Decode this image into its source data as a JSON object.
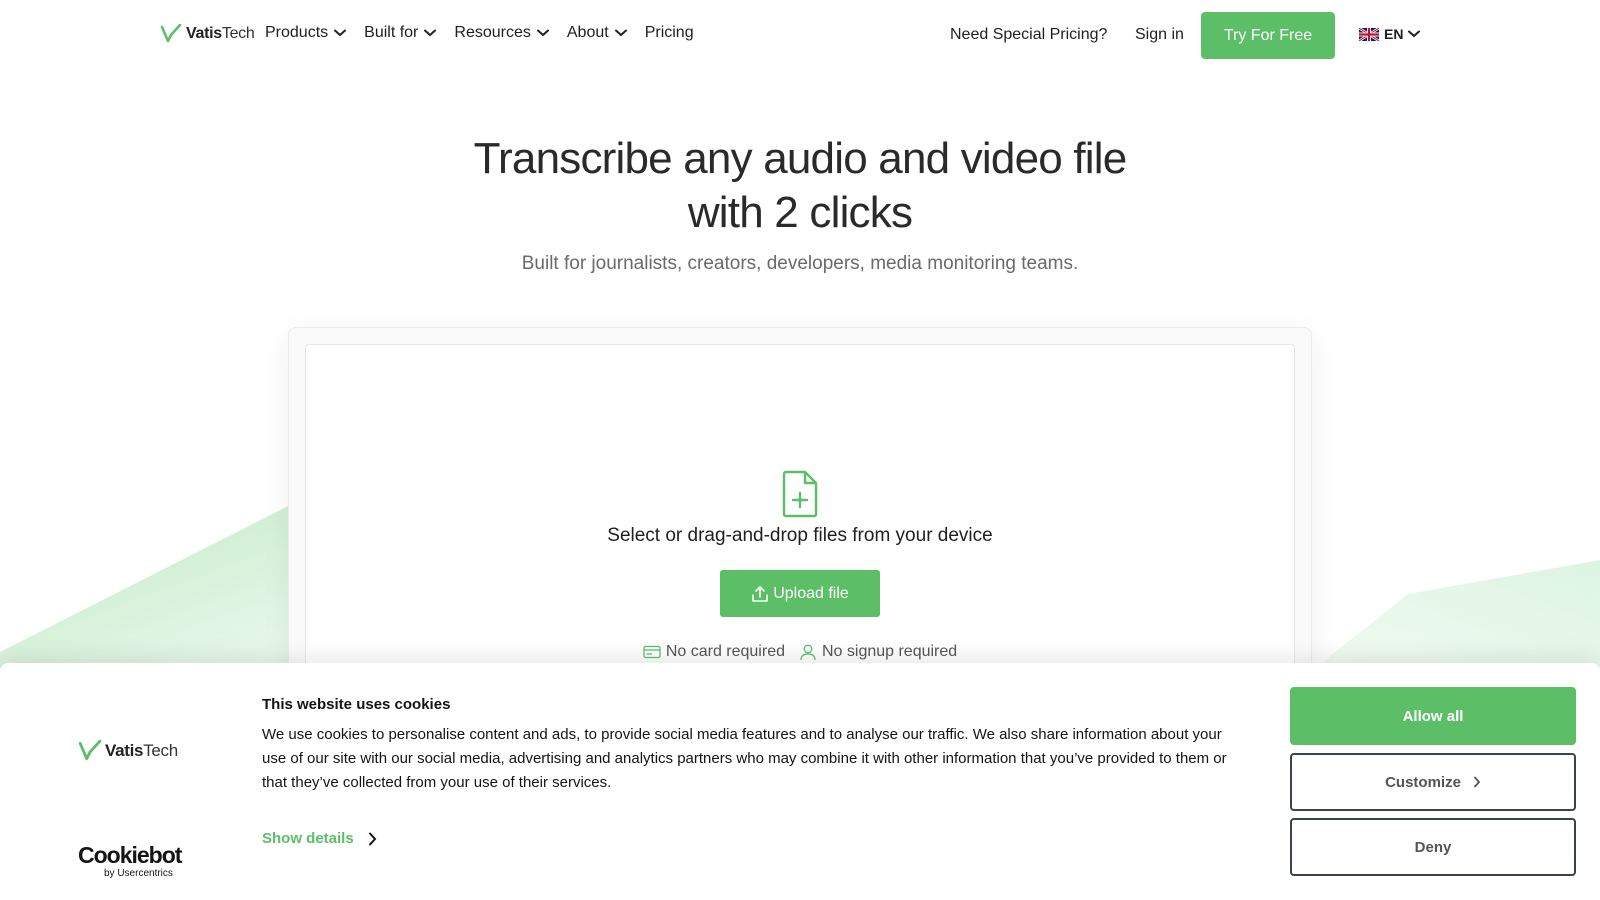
{
  "brand": {
    "name_bold": "Vatis",
    "name_light": "Tech",
    "accent_color": "#5cbf68"
  },
  "nav": {
    "items": [
      {
        "label": "Products",
        "has_dropdown": true
      },
      {
        "label": "Built for",
        "has_dropdown": true
      },
      {
        "label": "Resources",
        "has_dropdown": true
      },
      {
        "label": "About",
        "has_dropdown": true
      },
      {
        "label": "Pricing",
        "has_dropdown": false
      }
    ],
    "special_pricing": "Need Special Pricing?",
    "sign_in": "Sign in",
    "try_free": "Try For Free",
    "language": {
      "code": "EN",
      "flag_icon": "uk-flag-icon"
    }
  },
  "hero": {
    "title_line1": "Transcribe any audio and video file",
    "title_line2": "with 2 clicks",
    "subtitle": "Built for journalists, creators, developers, media monitoring teams."
  },
  "upload": {
    "icon": "file-plus-icon",
    "prompt": "Select or drag-and-drop files from your device",
    "button_label": "Upload file",
    "features": [
      {
        "icon": "credit-card-icon",
        "label": "No card required"
      },
      {
        "icon": "user-icon",
        "label": "No signup required"
      }
    ]
  },
  "cookie_banner": {
    "title": "This website uses cookies",
    "body": "We use cookies to personalise content and ads, to provide social media features and to analyse our traffic. We also share information about your use of our site with our social media, advertising and analytics partners who may combine it with other information that you’ve provided to them or that they’ve collected from your use of their services.",
    "show_details": "Show details",
    "allow_all": "Allow all",
    "customize": "Customize",
    "deny": "Deny",
    "provider_logo_word": "Cookiebot",
    "provider_logo_by": "by Usercentrics"
  }
}
